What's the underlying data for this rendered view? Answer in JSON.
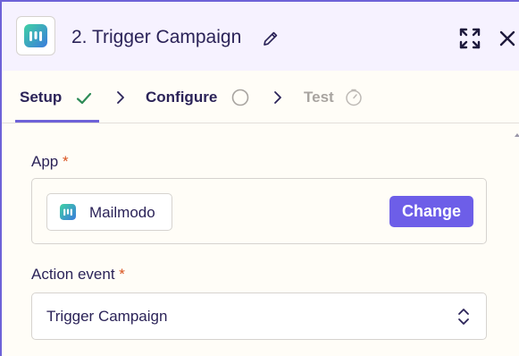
{
  "header": {
    "step_title": "2. Trigger Campaign",
    "app_icon": "mailmodo-logo",
    "edit_icon": "pencil-icon",
    "expand_icon": "expand-icon",
    "close_icon": "close-icon"
  },
  "tabs": [
    {
      "label": "Setup",
      "status": "complete",
      "status_icon": "check-icon",
      "active": true
    },
    {
      "label": "Configure",
      "status": "pending",
      "status_icon": "circle-icon",
      "active": false
    },
    {
      "label": "Test",
      "status": "disabled",
      "status_icon": "timer-icon",
      "active": false
    }
  ],
  "app_field": {
    "label": "App",
    "required_mark": "*",
    "app_name": "Mailmodo",
    "change_label": "Change"
  },
  "action_event": {
    "label": "Action event",
    "required_mark": "*",
    "value": "Trigger Campaign"
  },
  "colors": {
    "accent": "#6d5ee8",
    "required": "#d9531e",
    "check": "#2e8b57",
    "text": "#2b2358",
    "disabled": "#a8a4a0"
  }
}
